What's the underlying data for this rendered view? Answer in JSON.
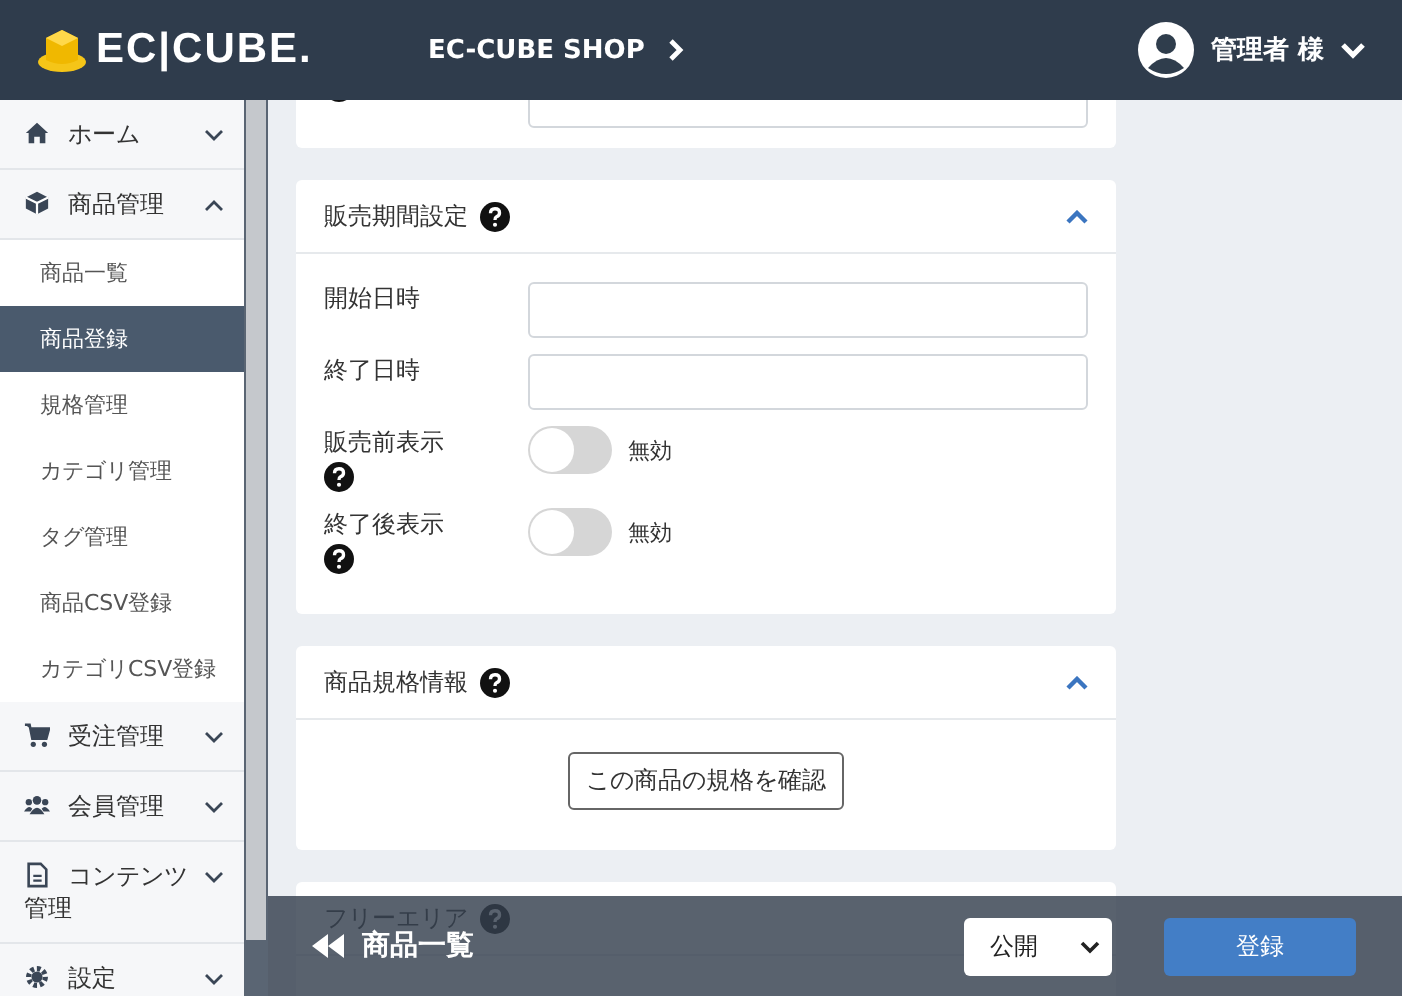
{
  "header": {
    "logo": "EC|CUBE.",
    "shop_name": "EC-CUBE SHOP",
    "user": "管理者 様"
  },
  "sidebar": {
    "items": [
      {
        "label": "ホーム",
        "expanded": false
      },
      {
        "label": "商品管理",
        "expanded": true,
        "children": [
          {
            "label": "商品一覧",
            "selected": false
          },
          {
            "label": "商品登録",
            "selected": true
          },
          {
            "label": "規格管理",
            "selected": false
          },
          {
            "label": "カテゴリ管理",
            "selected": false
          },
          {
            "label": "タグ管理",
            "selected": false
          },
          {
            "label": "商品CSV登録",
            "selected": false
          },
          {
            "label": "カテゴリCSV登録",
            "selected": false
          }
        ]
      },
      {
        "label": "受注管理",
        "expanded": false
      },
      {
        "label": "会員管理",
        "expanded": false
      },
      {
        "label": "コンテンツ管理",
        "expanded": false
      },
      {
        "label": "設定",
        "expanded": false
      }
    ]
  },
  "sales_period": {
    "title": "販売期間設定",
    "expanded": true,
    "rows": [
      {
        "kind": "input",
        "label": "開始日時",
        "help": false
      },
      {
        "kind": "input",
        "label": "終了日時",
        "help": false
      },
      {
        "kind": "toggle",
        "label": "販売前表示",
        "help": true,
        "on": false,
        "status": "無効"
      },
      {
        "kind": "toggle",
        "label": "終了後表示",
        "help": true,
        "on": false,
        "status": "無効"
      }
    ]
  },
  "product_class": {
    "title": "商品規格情報",
    "expanded": true,
    "button": "この商品の規格を確認"
  },
  "free_area": {
    "title": "フリーエリア"
  },
  "footer": {
    "back_link": "商品一覧",
    "status_select": "公開",
    "submit": "登録"
  }
}
